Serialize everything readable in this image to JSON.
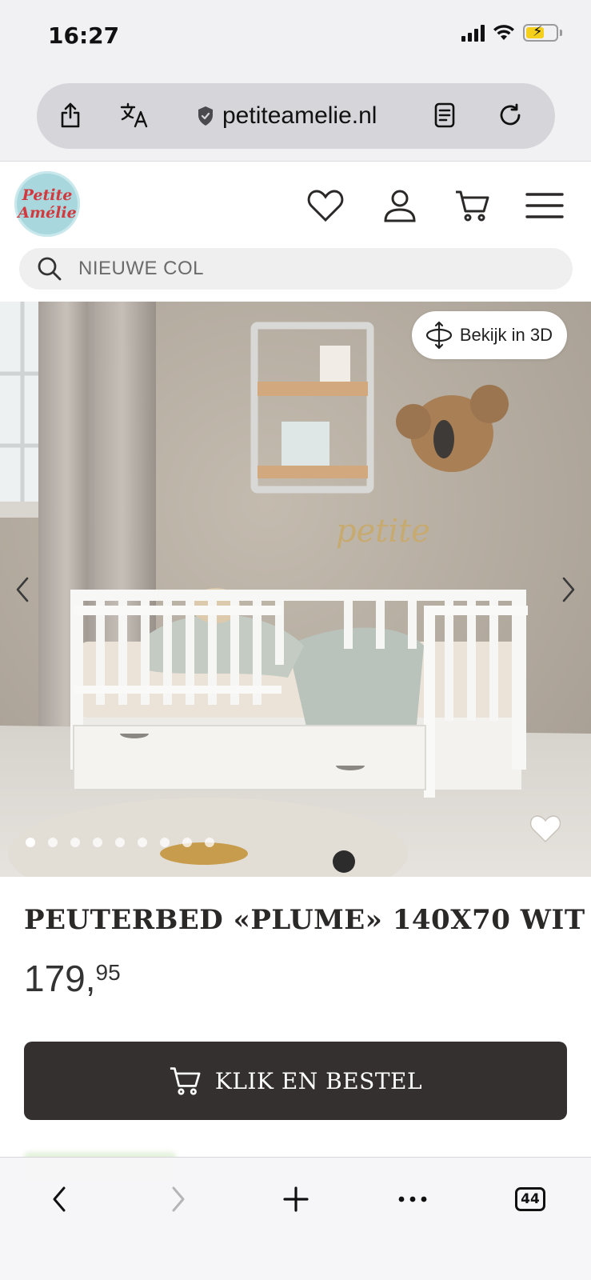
{
  "status_bar": {
    "time": "16:27"
  },
  "browser": {
    "url": "petiteamelie.nl",
    "tab_count": "44"
  },
  "site": {
    "logo_line1": "Petite",
    "logo_line2": "Amélie",
    "search_placeholder": "NIEUWE COL"
  },
  "product": {
    "view_3d_label": "Bekijk in 3D",
    "gallery": {
      "dot_count": 9,
      "active_index": 0
    },
    "title": "PEUTERBED «PLUME» 140X70 WIT",
    "price_main": "179,",
    "price_cents": "95",
    "order_button_label": "KLIK EN BESTEL"
  },
  "colors": {
    "button_bg": "#353030",
    "logo_bg": "#a9d7de",
    "logo_text": "#d2393f",
    "battery": "#f4d01d"
  },
  "icons": {
    "share": "share-icon",
    "translate": "translate-icon",
    "shield": "shield-icon",
    "reader": "reader-icon",
    "reload": "reload-icon",
    "wishlist": "heart-icon",
    "account": "user-icon",
    "cart": "cart-icon",
    "menu": "hamburger-icon",
    "search": "search-icon",
    "rotate3d": "rotate-3d-icon",
    "back": "chevron-left-icon",
    "forward": "chevron-right-icon",
    "new_tab": "plus-icon",
    "more": "ellipsis-icon",
    "tabs": "tabs-icon"
  }
}
